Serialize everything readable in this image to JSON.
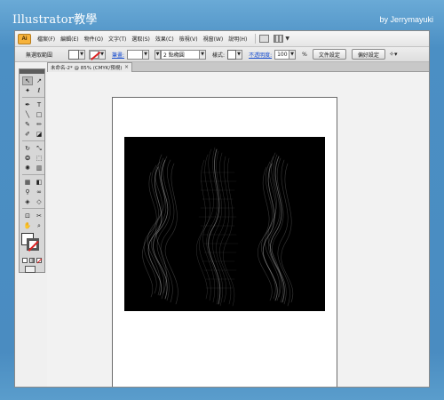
{
  "banner": {
    "title": "Illustrator教學",
    "credit": "by Jerrymayuki"
  },
  "app": {
    "logo": "Ai",
    "menu": [
      "檔案(F)",
      "編輯(E)",
      "物件(O)",
      "文字(T)",
      "選取(S)",
      "效果(C)",
      "檢視(V)",
      "視窗(W)",
      "說明(H)"
    ],
    "menubar_icons": [
      "bridge-icon",
      "arrange-documents-icon"
    ]
  },
  "control_bar": {
    "selection_label": "無選取範圍",
    "stroke_label": "筆畫:",
    "stroke_weight": "",
    "brush_value": "2 點橢圓",
    "style_label": "樣式:",
    "opacity_label": "不透明度:",
    "opacity_value": "100",
    "opacity_unit": "%",
    "document_setup_button": "文件設定",
    "preferences_button": "偏好設定"
  },
  "document_tab": {
    "title": "未命名-2* @ 85% (CMYK/預視)",
    "close": "×"
  },
  "toolbox": {
    "tools": [
      {
        "icon": "selection-tool-icon",
        "glyph": "↖"
      },
      {
        "icon": "direct-selection-tool-icon",
        "glyph": "↗"
      },
      {
        "icon": "magic-wand-tool-icon",
        "glyph": "✦"
      },
      {
        "icon": "lasso-tool-icon",
        "glyph": "ℓ"
      },
      {
        "icon": "pen-tool-icon",
        "glyph": "✒"
      },
      {
        "icon": "type-tool-icon",
        "glyph": "T"
      },
      {
        "icon": "line-tool-icon",
        "glyph": "╲"
      },
      {
        "icon": "rectangle-tool-icon",
        "glyph": "□"
      },
      {
        "icon": "paintbrush-tool-icon",
        "glyph": "✎"
      },
      {
        "icon": "pencil-tool-icon",
        "glyph": "✏"
      },
      {
        "icon": "blob-brush-tool-icon",
        "glyph": "✐"
      },
      {
        "icon": "eraser-tool-icon",
        "glyph": "◪"
      },
      {
        "icon": "rotate-tool-icon",
        "glyph": "↻"
      },
      {
        "icon": "scale-tool-icon",
        "glyph": "⤡"
      },
      {
        "icon": "warp-tool-icon",
        "glyph": "❂"
      },
      {
        "icon": "free-transform-tool-icon",
        "glyph": "⬚"
      },
      {
        "icon": "symbol-sprayer-tool-icon",
        "glyph": "✺"
      },
      {
        "icon": "column-graph-tool-icon",
        "glyph": "▥"
      },
      {
        "icon": "mesh-tool-icon",
        "glyph": "▦"
      },
      {
        "icon": "gradient-tool-icon",
        "glyph": "◧"
      },
      {
        "icon": "eyedropper-tool-icon",
        "glyph": "⚲"
      },
      {
        "icon": "blend-tool-icon",
        "glyph": "∞"
      },
      {
        "icon": "live-paint-bucket-icon",
        "glyph": "◈"
      },
      {
        "icon": "live-paint-selection-icon",
        "glyph": "◇"
      },
      {
        "icon": "artboard-tool-icon",
        "glyph": "⊡"
      },
      {
        "icon": "slice-tool-icon",
        "glyph": "✂"
      },
      {
        "icon": "hand-tool-icon",
        "glyph": "✋"
      },
      {
        "icon": "zoom-tool-icon",
        "glyph": "⌕"
      }
    ]
  }
}
